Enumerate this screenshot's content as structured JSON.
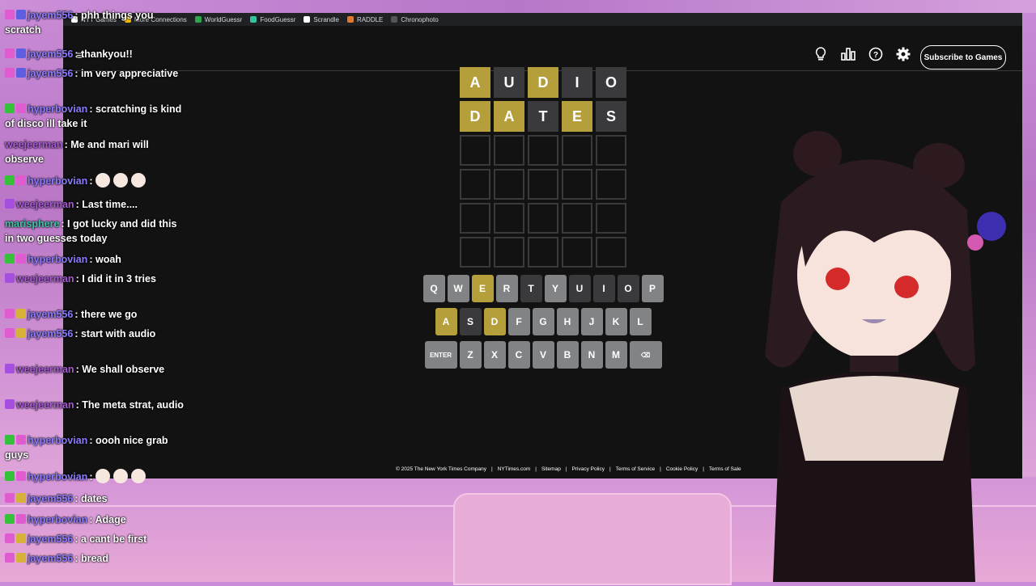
{
  "bookmarks": [
    {
      "label": "NYT Games",
      "color": "#ffffff"
    },
    {
      "label": "More Connections",
      "color": "#f5b800"
    },
    {
      "label": "WorldGuessr",
      "color": "#2ea44f"
    },
    {
      "label": "FoodGuessr",
      "color": "#35c0a0"
    },
    {
      "label": "Scrandle",
      "color": "#ffffff"
    },
    {
      "label": "RADDLE",
      "color": "#e07a2e"
    },
    {
      "label": "Chronophoto",
      "color": "#555555"
    }
  ],
  "nav": {
    "subscribe_label": "Subscribe to Games",
    "hamburger": "≡"
  },
  "board": {
    "rows": [
      [
        {
          "l": "A",
          "s": "present"
        },
        {
          "l": "U",
          "s": "absent"
        },
        {
          "l": "D",
          "s": "present"
        },
        {
          "l": "I",
          "s": "absent"
        },
        {
          "l": "O",
          "s": "absent"
        }
      ],
      [
        {
          "l": "D",
          "s": "present"
        },
        {
          "l": "A",
          "s": "present"
        },
        {
          "l": "T",
          "s": "absent"
        },
        {
          "l": "E",
          "s": "present"
        },
        {
          "l": "S",
          "s": "absent"
        }
      ],
      [
        {
          "l": "",
          "s": "empty"
        },
        {
          "l": "",
          "s": "empty"
        },
        {
          "l": "",
          "s": "empty"
        },
        {
          "l": "",
          "s": "empty"
        },
        {
          "l": "",
          "s": "empty"
        }
      ],
      [
        {
          "l": "",
          "s": "empty"
        },
        {
          "l": "",
          "s": "empty"
        },
        {
          "l": "",
          "s": "empty"
        },
        {
          "l": "",
          "s": "empty"
        },
        {
          "l": "",
          "s": "empty"
        }
      ],
      [
        {
          "l": "",
          "s": "empty"
        },
        {
          "l": "",
          "s": "empty"
        },
        {
          "l": "",
          "s": "empty"
        },
        {
          "l": "",
          "s": "empty"
        },
        {
          "l": "",
          "s": "empty"
        }
      ],
      [
        {
          "l": "",
          "s": "empty"
        },
        {
          "l": "",
          "s": "empty"
        },
        {
          "l": "",
          "s": "empty"
        },
        {
          "l": "",
          "s": "empty"
        },
        {
          "l": "",
          "s": "empty"
        }
      ]
    ]
  },
  "keyboard": {
    "rows": [
      [
        {
          "k": "Q",
          "s": "unused"
        },
        {
          "k": "W",
          "s": "unused"
        },
        {
          "k": "E",
          "s": "present"
        },
        {
          "k": "R",
          "s": "unused"
        },
        {
          "k": "T",
          "s": "absent"
        },
        {
          "k": "Y",
          "s": "unused"
        },
        {
          "k": "U",
          "s": "absent"
        },
        {
          "k": "I",
          "s": "absent"
        },
        {
          "k": "O",
          "s": "absent"
        },
        {
          "k": "P",
          "s": "unused"
        }
      ],
      [
        {
          "k": "A",
          "s": "present"
        },
        {
          "k": "S",
          "s": "absent"
        },
        {
          "k": "D",
          "s": "present"
        },
        {
          "k": "F",
          "s": "unused"
        },
        {
          "k": "G",
          "s": "unused"
        },
        {
          "k": "H",
          "s": "unused"
        },
        {
          "k": "J",
          "s": "unused"
        },
        {
          "k": "K",
          "s": "unused"
        },
        {
          "k": "L",
          "s": "unused"
        }
      ],
      [
        {
          "k": "ENTER",
          "s": "unused",
          "wide": true
        },
        {
          "k": "Z",
          "s": "unused"
        },
        {
          "k": "X",
          "s": "unused"
        },
        {
          "k": "C",
          "s": "unused"
        },
        {
          "k": "V",
          "s": "unused"
        },
        {
          "k": "B",
          "s": "unused"
        },
        {
          "k": "N",
          "s": "unused"
        },
        {
          "k": "M",
          "s": "unused"
        },
        {
          "k": "⌫",
          "s": "unused",
          "wide": true
        }
      ]
    ]
  },
  "footer": [
    "© 2025 The New York Times Company",
    "NYTimes.com",
    "Sitemap",
    "Privacy Policy",
    "Terms of Service",
    "Cookie Policy",
    "Terms of Sale"
  ],
  "chat": [
    {
      "badges": [
        "pink",
        "blue"
      ],
      "user": "jayem556",
      "color": "#8a7cff",
      "text": "phh things you scratch"
    },
    {
      "badges": [
        "pink",
        "blue"
      ],
      "user": "jayem556",
      "color": "#8a7cff",
      "text": "thankyou!!"
    },
    {
      "badges": [
        "pink",
        "blue"
      ],
      "user": "jayem556",
      "color": "#8a7cff",
      "text": "im very appreciative"
    },
    {
      "badges": [
        "green",
        "pink"
      ],
      "user": "hyperbovian",
      "color": "#8a7cff",
      "text": "scratching is kind of disco ill take it"
    },
    {
      "badges": [],
      "user": "weejeerman",
      "color": "#a85ad8",
      "text": "Me and mari will observe"
    },
    {
      "badges": [
        "green",
        "pink"
      ],
      "user": "hyperbovian",
      "color": "#8a7cff",
      "text": "",
      "emotes": 3
    },
    {
      "badges": [
        "purple"
      ],
      "user": "weejeerman",
      "color": "#a85ad8",
      "text": "Last time...."
    },
    {
      "badges": [],
      "user": "marisphere",
      "color": "#3cc6a8",
      "text": "I got lucky and did this in two guesses today"
    },
    {
      "badges": [
        "green",
        "pink"
      ],
      "user": "hyperbovian",
      "color": "#8a7cff",
      "text": "woah"
    },
    {
      "badges": [
        "purple"
      ],
      "user": "weejeerman",
      "color": "#a85ad8",
      "text": "I did it in 3 tries"
    },
    {
      "badges": [
        "pink",
        "gold"
      ],
      "user": "jayem556",
      "color": "#8a7cff",
      "text": "there we go"
    },
    {
      "badges": [
        "pink",
        "gold"
      ],
      "user": "jayem556",
      "color": "#8a7cff",
      "text": "start with audio"
    },
    {
      "badges": [
        "purple"
      ],
      "user": "weejeerman",
      "color": "#a85ad8",
      "text": "We shall observe"
    },
    {
      "badges": [
        "purple"
      ],
      "user": "weejeerman",
      "color": "#a85ad8",
      "text": "The meta strat, audio"
    },
    {
      "badges": [
        "green",
        "pink"
      ],
      "user": "hyperbovian",
      "color": "#8a7cff",
      "text": "oooh nice grab guys"
    },
    {
      "badges": [
        "green",
        "pink"
      ],
      "user": "hyperbovian",
      "color": "#8a7cff",
      "text": "",
      "emotes": 3
    },
    {
      "badges": [
        "pink",
        "gold"
      ],
      "user": "jayem556",
      "color": "#8a7cff",
      "text": "dates"
    },
    {
      "badges": [
        "green",
        "pink"
      ],
      "user": "hyperbovian",
      "color": "#8a7cff",
      "text": "Adage"
    },
    {
      "badges": [
        "pink",
        "gold"
      ],
      "user": "jayem556",
      "color": "#8a7cff",
      "text": "a cant be first"
    },
    {
      "badges": [
        "pink",
        "gold"
      ],
      "user": "jayem556",
      "color": "#8a7cff",
      "text": "bread"
    }
  ]
}
